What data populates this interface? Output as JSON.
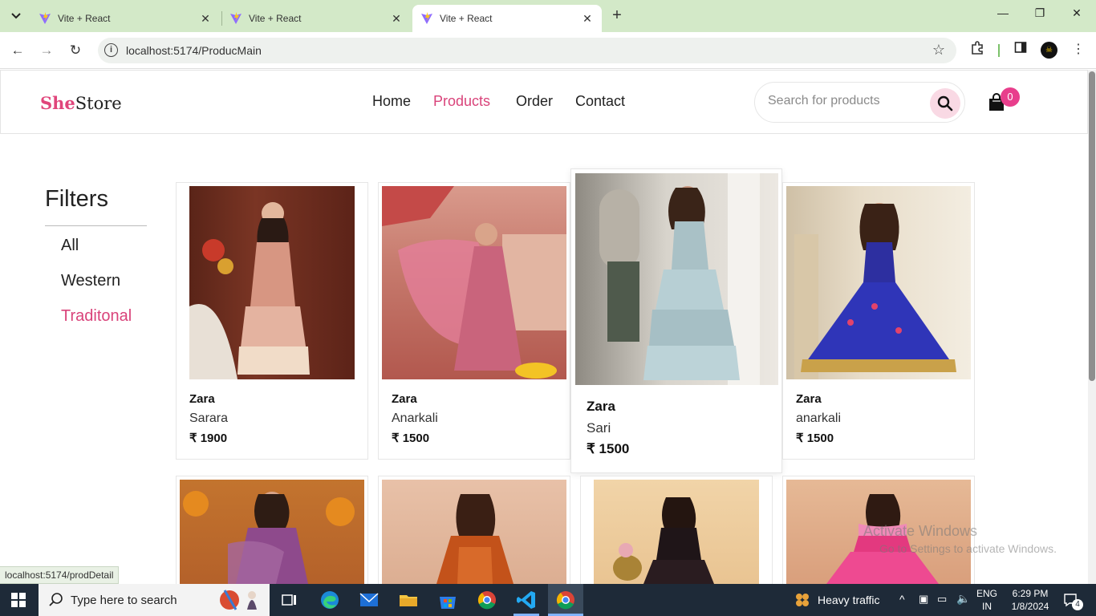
{
  "browser": {
    "tabs": [
      {
        "title": "Vite + React",
        "active": false
      },
      {
        "title": "Vite + React",
        "active": false
      },
      {
        "title": "Vite + React",
        "active": true
      }
    ],
    "url": "localhost:5174/ProducMain",
    "status_url": "localhost:5174/prodDetail"
  },
  "header": {
    "logo_she": "She",
    "logo_store": "Store",
    "nav": [
      "Home",
      "Products",
      "Order",
      "Contact"
    ],
    "active_nav": "Products",
    "search_placeholder": "Search for products",
    "cart_count": "0"
  },
  "filters": {
    "title": "Filters",
    "items": [
      "All",
      "Western",
      "Traditonal"
    ],
    "active": "Traditonal"
  },
  "products": [
    {
      "brand": "Zara",
      "name": "Sarara",
      "price": "₹ 1900"
    },
    {
      "brand": "Zara",
      "name": "Anarkali",
      "price": "₹ 1500"
    },
    {
      "brand": "Zara",
      "name": "Sari",
      "price": "₹ 1500"
    },
    {
      "brand": "Zara",
      "name": "anarkali",
      "price": "₹ 1500"
    }
  ],
  "watermark": {
    "line1": "Activate Windows",
    "line2": "Go to Settings to activate Windows."
  },
  "taskbar": {
    "search_placeholder": "Type here to search",
    "weather": "Heavy traffic",
    "lang1": "ENG",
    "lang2": "IN",
    "time": "6:29 PM",
    "date": "1/8/2024",
    "notifications": "4"
  },
  "colors": {
    "accent": "#d9437a",
    "badge": "#e83e8c",
    "tabstrip": "#d3e9c8",
    "taskbar": "#1e2a38"
  }
}
